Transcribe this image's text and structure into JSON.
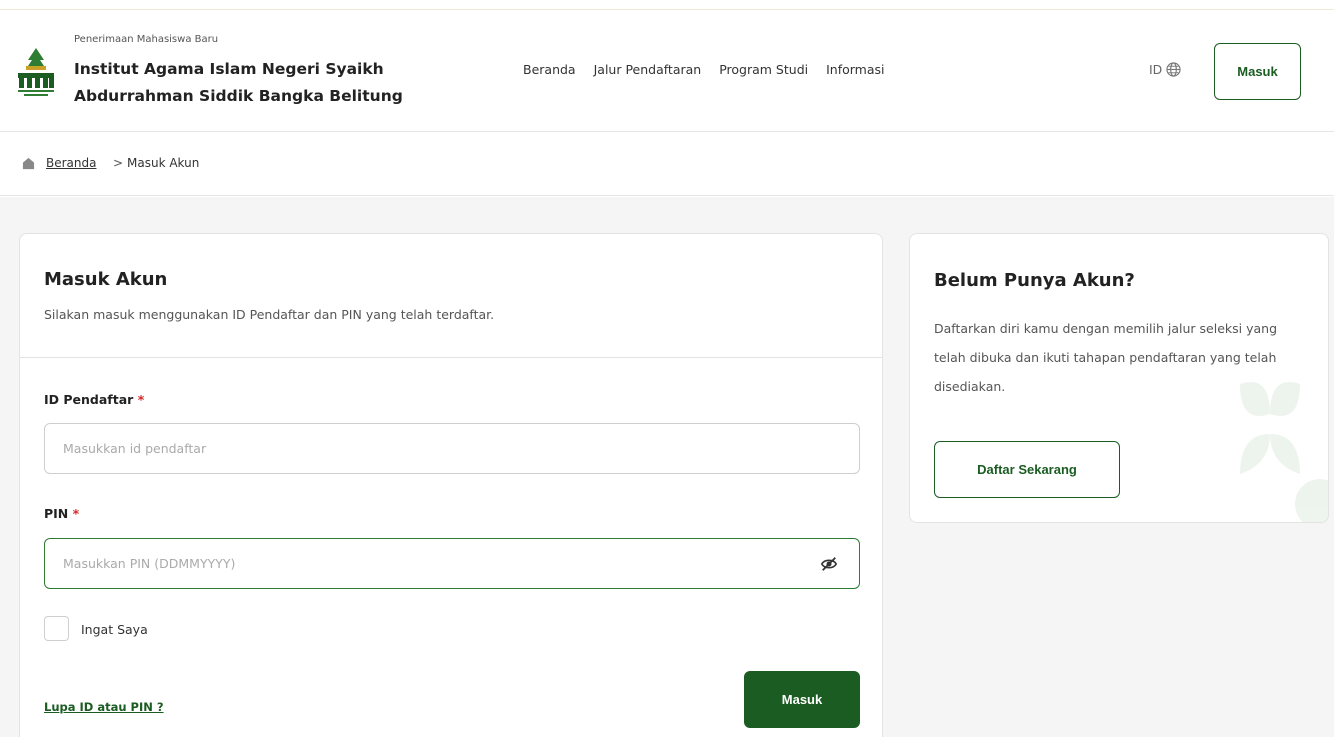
{
  "header": {
    "subtitle": "Penerimaan Mahasiswa Baru",
    "title": "Institut Agama Islam Negeri Syaikh Abdurrahman Siddik Bangka Belitung",
    "nav": [
      "Beranda",
      "Jalur Pendaftaran",
      "Program Studi",
      "Informasi"
    ],
    "lang": "ID",
    "login_button": "Masuk"
  },
  "breadcrumb": {
    "home": "Beranda",
    "separator": ">",
    "current": "Masuk Akun"
  },
  "login": {
    "title": "Masuk Akun",
    "subtitle": "Silakan masuk menggunakan ID Pendaftar dan PIN yang telah terdaftar.",
    "id_label": "ID Pendaftar",
    "id_placeholder": "Masukkan id pendaftar",
    "id_value": "",
    "pin_label": "PIN",
    "pin_placeholder": "Masukkan PIN (DDMMYYYY)",
    "pin_value": "",
    "required_mark": "*",
    "remember_label": "Ingat Saya",
    "forgot_link": "Lupa ID atau PIN ?",
    "submit_label": "Masuk"
  },
  "signup": {
    "title": "Belum Punya Akun?",
    "text": "Daftarkan diri kamu dengan memilih jalur seleksi yang telah dibuka dan ikuti tahapan pendaftaran yang telah disediakan.",
    "button": "Daftar Sekarang"
  },
  "colors": {
    "primary": "#1a5c21",
    "required": "#d62828",
    "background": "#f5f5f5"
  },
  "icons": [
    "logo-icon",
    "globe-icon",
    "home-icon",
    "eye-slash-icon"
  ]
}
